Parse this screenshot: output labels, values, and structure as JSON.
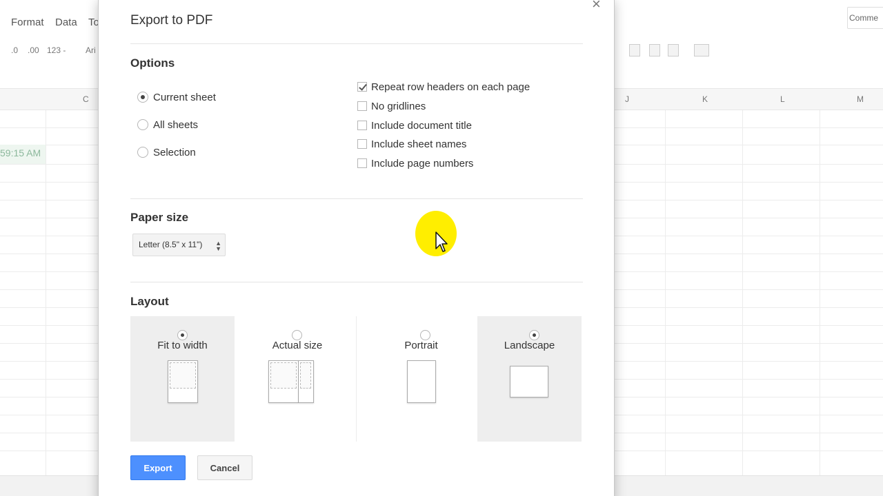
{
  "background": {
    "menu": [
      "Format",
      "Data",
      "To"
    ],
    "toolbar": [
      ".0",
      ".00",
      "123 -",
      "Ari"
    ],
    "comments_button": "Comme",
    "columns": [
      "C",
      "J",
      "K",
      "L",
      "M"
    ],
    "cell_value": "59:15 AM"
  },
  "dialog": {
    "title": "Export to PDF",
    "close_label": "×",
    "options": {
      "title": "Options",
      "scope": [
        {
          "label": "Current sheet",
          "checked": true
        },
        {
          "label": "All sheets",
          "checked": false
        },
        {
          "label": "Selection",
          "checked": false
        }
      ],
      "checks": [
        {
          "label": "Repeat row headers on each page",
          "checked": true
        },
        {
          "label": "No gridlines",
          "checked": false
        },
        {
          "label": "Include document title",
          "checked": false
        },
        {
          "label": "Include sheet names",
          "checked": false
        },
        {
          "label": "Include page numbers",
          "checked": false
        }
      ]
    },
    "paper_size": {
      "title": "Paper size",
      "selected": "Letter (8.5\" x 11\")"
    },
    "layout": {
      "title": "Layout",
      "fit_to_width": "Fit to width",
      "actual_size": "Actual size",
      "portrait": "Portrait",
      "landscape": "Landscape",
      "selected_scale": "Fit to width",
      "selected_orientation": "Landscape"
    },
    "buttons": {
      "export": "Export",
      "cancel": "Cancel"
    }
  },
  "colors": {
    "primary_button": "#4d90fe",
    "cursor_highlight": "#ffee00"
  }
}
